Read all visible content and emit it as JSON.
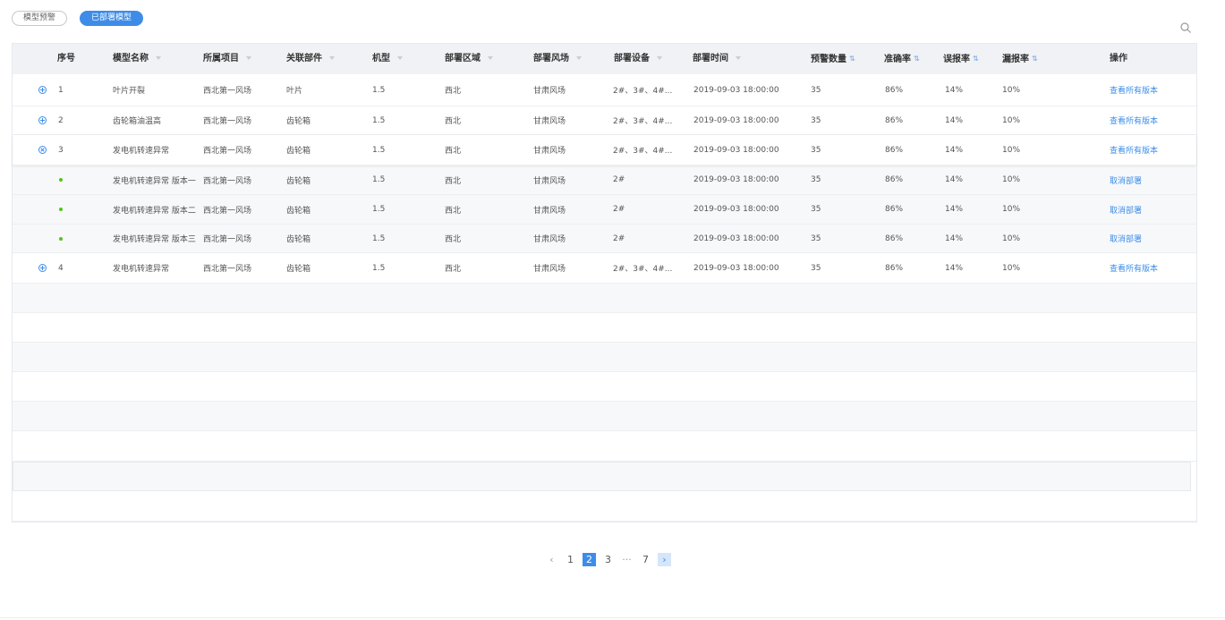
{
  "tabs": [
    {
      "label": "模型预警",
      "active": false
    },
    {
      "label": "已部署模型",
      "active": true
    }
  ],
  "search": {
    "icon": "search-icon"
  },
  "table": {
    "headers": [
      {
        "label": "序号",
        "mark": ""
      },
      {
        "label": "模型名称",
        "mark": "filter"
      },
      {
        "label": "所属项目",
        "mark": "filter"
      },
      {
        "label": "关联部件",
        "mark": "filter"
      },
      {
        "label": "机型",
        "mark": "filter"
      },
      {
        "label": "部署区域",
        "mark": "filter"
      },
      {
        "label": "部署风场",
        "mark": "filter"
      },
      {
        "label": "部署设备",
        "mark": "filter"
      },
      {
        "label": "部署时间",
        "mark": "filter"
      },
      {
        "label": "预警数量",
        "mark": "sort"
      },
      {
        "label": "准确率",
        "mark": "sort"
      },
      {
        "label": "误报率",
        "mark": "sort"
      },
      {
        "label": "漏报率",
        "mark": "sort"
      },
      {
        "label": "操作",
        "mark": ""
      }
    ],
    "rows": [
      {
        "kind": "main",
        "expanded": false,
        "cells": [
          "1",
          "叶片开裂",
          "西北第一风场",
          "叶片",
          "1.5",
          "西北",
          "甘肃风场",
          "2#、3#、4#...",
          "2019-09-03  18:00:00",
          "35",
          "86%",
          "14%",
          "10%"
        ],
        "action": "查看所有版本"
      },
      {
        "kind": "main",
        "expanded": false,
        "cells": [
          "2",
          "齿轮箱油温高",
          "西北第一风场",
          "齿轮箱",
          "1.5",
          "西北",
          "甘肃风场",
          "2#、3#、4#...",
          "2019-09-03  18:00:00",
          "35",
          "86%",
          "14%",
          "10%"
        ],
        "action": "查看所有版本"
      },
      {
        "kind": "main",
        "expanded": true,
        "cells": [
          "3",
          "发电机转速异常",
          "西北第一风场",
          "齿轮箱",
          "1.5",
          "西北",
          "甘肃风场",
          "2#、3#、4#...",
          "2019-09-03  18:00:00",
          "35",
          "86%",
          "14%",
          "10%"
        ],
        "action": "查看所有版本"
      },
      {
        "kind": "sub",
        "cells": [
          "",
          "发电机转速异常 版本一",
          "西北第一风场",
          "齿轮箱",
          "1.5",
          "西北",
          "甘肃风场",
          "2#",
          "2019-09-03  18:00:00",
          "35",
          "86%",
          "14%",
          "10%"
        ],
        "action": "取消部署"
      },
      {
        "kind": "sub",
        "cells": [
          "",
          "发电机转速异常 版本二",
          "西北第一风场",
          "齿轮箱",
          "1.5",
          "西北",
          "甘肃风场",
          "2#",
          "2019-09-03  18:00:00",
          "35",
          "86%",
          "14%",
          "10%"
        ],
        "action": "取消部署"
      },
      {
        "kind": "sub",
        "cells": [
          "",
          "发电机转速异常 版本三",
          "西北第一风场",
          "齿轮箱",
          "1.5",
          "西北",
          "甘肃风场",
          "2#",
          "2019-09-03  18:00:00",
          "35",
          "86%",
          "14%",
          "10%"
        ],
        "action": "取消部署"
      },
      {
        "kind": "main",
        "expanded": false,
        "cells": [
          "4",
          "发电机转速异常",
          "西北第一风场",
          "齿轮箱",
          "1.5",
          "西北",
          "甘肃风场",
          "2#、3#、4#...",
          "2019-09-03  18:00:00",
          "35",
          "86%",
          "14%",
          "10%"
        ],
        "action": "查看所有版本"
      }
    ]
  },
  "pagination": {
    "prev": "‹",
    "next": "›",
    "pages": [
      "1",
      "2",
      "3",
      "···",
      "7"
    ],
    "current": "2"
  },
  "colors": {
    "accent": "#3d8de8",
    "dot": "#52c41a",
    "header_bg": "#f0f2f5"
  }
}
